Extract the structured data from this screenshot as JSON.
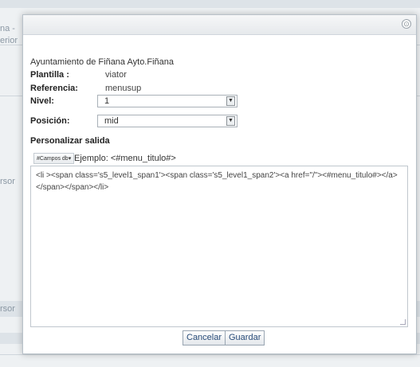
{
  "background": {
    "fragments": [
      "na -",
      "erior",
      "rsor"
    ]
  },
  "modal": {
    "close_glyph": "⊙",
    "title": "Ayuntamiento de Fiñana Ayto.Fiñana",
    "fields": {
      "plantilla_label": "Plantilla :",
      "plantilla_value": "viator",
      "referencia_label": "Referencia:",
      "referencia_value": "menusup",
      "nivel_label": "Nivel:",
      "nivel_value": "1",
      "posicion_label": "Posición:",
      "posicion_value": "mid"
    },
    "section_title": "Personalizar salida",
    "campos_button": "#Campos db▾",
    "ejemplo": "Ejemplo: <#menu_titulo#>",
    "code": "<li ><span class='s5_level1_span1'><span class='s5_level1_span2'><a href=\"/\"><#menu_titulo#></a></span></span></li>",
    "buttons": {
      "cancel": "Cancelar",
      "save": "Guardar"
    }
  },
  "colors": {
    "button_text": "#2a4d7a",
    "modal_bg": "#ffffff",
    "page_bg": "#eef1f3"
  }
}
